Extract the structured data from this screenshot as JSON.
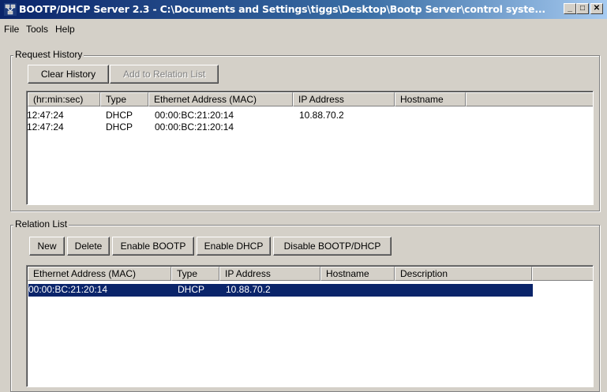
{
  "window": {
    "title": "BOOTP/DHCP Server 2.3 - C:\\Documents and Settings\\tiggs\\Desktop\\Bootp Server\\control syste...",
    "minimize_glyph": "_",
    "maximize_glyph": "□",
    "close_glyph": "✕"
  },
  "menu": {
    "file": "File",
    "tools": "Tools",
    "help": "Help"
  },
  "request_history": {
    "label": "Request History",
    "buttons": {
      "clear": "Clear History",
      "add": "Add to Relation List"
    },
    "columns": [
      "(hr:min:sec)",
      "Type",
      "Ethernet Address (MAC)",
      "IP Address",
      "Hostname"
    ],
    "rows": [
      {
        "time": "12:47:24",
        "type": "DHCP",
        "mac": "00:00:BC:21:20:14",
        "ip": "10.88.70.2",
        "host": ""
      },
      {
        "time": "12:47:24",
        "type": "DHCP",
        "mac": "00:00:BC:21:20:14",
        "ip": "",
        "host": ""
      }
    ]
  },
  "relation_list": {
    "label": "Relation List",
    "buttons": {
      "new": "New",
      "delete": "Delete",
      "enable_bootp": "Enable BOOTP",
      "enable_dhcp": "Enable DHCP",
      "disable": "Disable BOOTP/DHCP"
    },
    "columns": [
      "Ethernet Address (MAC)",
      "Type",
      "IP Address",
      "Hostname",
      "Description"
    ],
    "rows": [
      {
        "mac": "00:00:BC:21:20:14",
        "type": "DHCP",
        "ip": "10.88.70.2",
        "host": "",
        "desc": "",
        "selected": true
      }
    ]
  },
  "colors": {
    "title_start": "#0a246a",
    "title_end": "#a6caf0",
    "selection": "#0a246a",
    "face": "#d4d0c8"
  }
}
